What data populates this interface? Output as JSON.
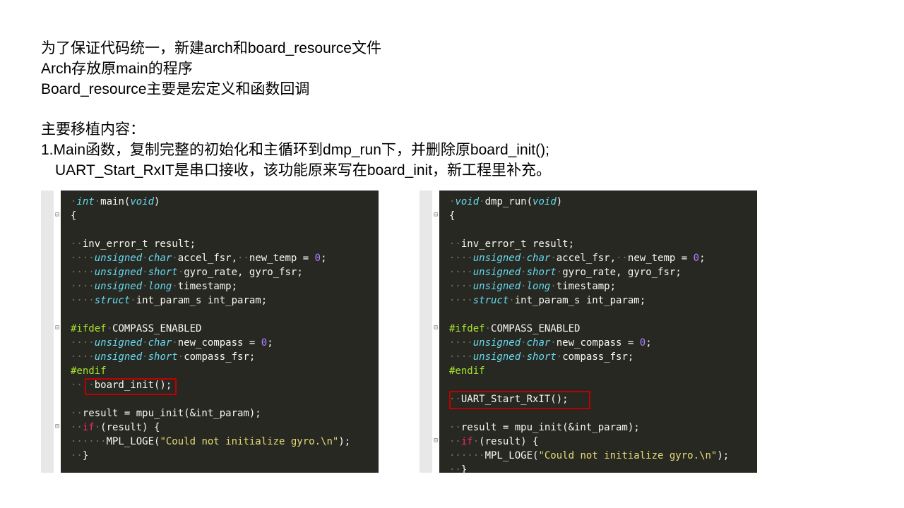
{
  "desc": {
    "l1": "为了保证代码统一，新建arch和board_resource文件",
    "l2": "Arch存放原main的程序",
    "l3": "Board_resource主要是宏定义和函数回调",
    "l4": "主要移植内容：",
    "l5": "1.Main函数，复制完整的初始化和主循环到dmp_run下，并删除原board_init();",
    "l6": "UART_Start_RxIT是串口接收，该功能原来写在board_init，新工程里补充。"
  },
  "code_left": {
    "ret_type": "int",
    "fn_name": "main",
    "fn_arg": "void",
    "var1": "inv_error_t result;",
    "u_char": "unsigned",
    "char": "char",
    "accel": "accel_fsr,",
    "newtemp": "new_temp = ",
    "zero": "0",
    "short": "short",
    "gyro": "gyro_rate, gyro_fsr;",
    "long": "long",
    "ts": "timestamp;",
    "struct": "struct",
    "int_param": "int_param_s int_param;",
    "ifdef": "#ifdef",
    "compass": "COMPASS_ENABLED",
    "newcomp": "new_compass = ",
    "compfsr": "compass_fsr;",
    "endif": "#endif",
    "board_init": "board_init();",
    "result_line": "result = mpu_init(&int_param);",
    "if": "if",
    "if_cond": "(result) {",
    "log": "MPL_LOGE(",
    "log_str": "\"Could not initialize gyro.\\n\"",
    "log_end": ");",
    "close": "}"
  },
  "code_right": {
    "ret_type": "void",
    "fn_name": "dmp_run",
    "fn_arg": "void",
    "uart": "UART_Start_RxIT();"
  }
}
